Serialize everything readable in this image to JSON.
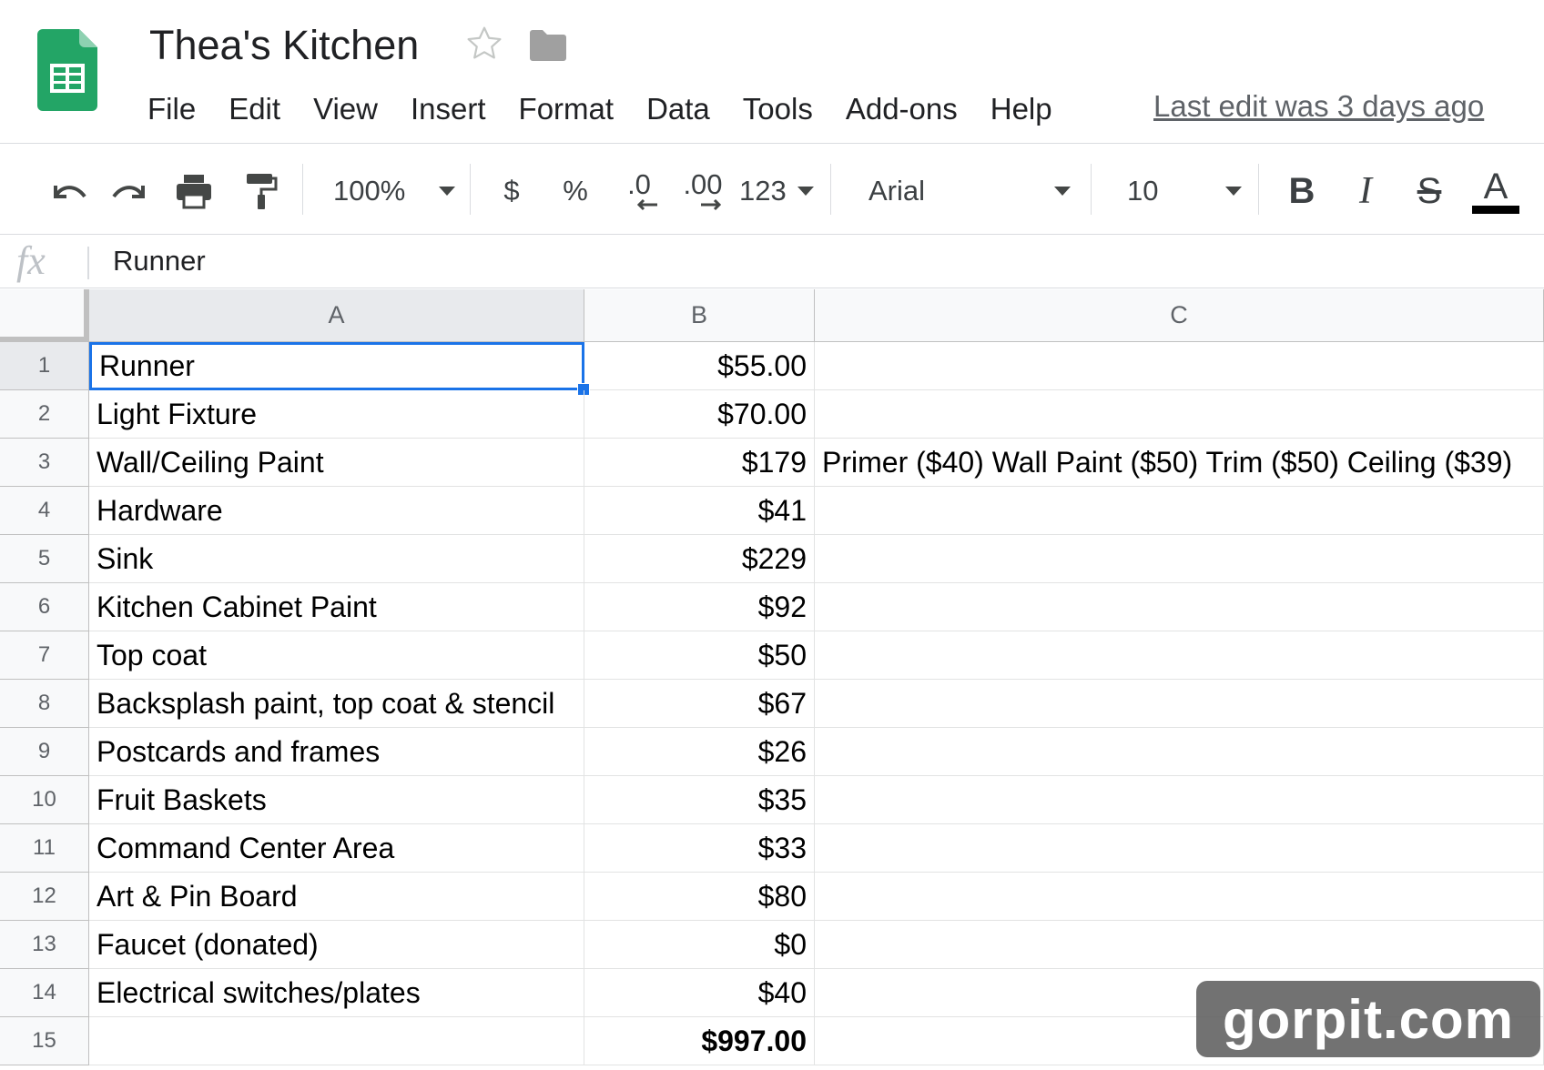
{
  "header": {
    "title": "Thea's Kitchen",
    "menu": [
      "File",
      "Edit",
      "View",
      "Insert",
      "Format",
      "Data",
      "Tools",
      "Add-ons",
      "Help"
    ],
    "last_edit": "Last edit was 3 days ago"
  },
  "toolbar": {
    "zoom": "100%",
    "currency": "$",
    "percent": "%",
    "decrease_decimal": ".0",
    "increase_decimal": ".00",
    "more_formats": "123",
    "font": "Arial",
    "font_size": "10",
    "bold": "B",
    "italic": "I",
    "strike": "S",
    "text_color": "A"
  },
  "formula_bar": {
    "fx": "fx",
    "value": "Runner"
  },
  "grid": {
    "columns": [
      "A",
      "B",
      "C"
    ],
    "rows": [
      {
        "n": "1",
        "a": "Runner",
        "b": "$55.00",
        "c": ""
      },
      {
        "n": "2",
        "a": "Light Fixture",
        "b": "$70.00",
        "c": ""
      },
      {
        "n": "3",
        "a": "Wall/Ceiling Paint",
        "b": "$179",
        "c": "Primer ($40) Wall Paint ($50) Trim ($50) Ceiling ($39)"
      },
      {
        "n": "4",
        "a": "Hardware",
        "b": "$41",
        "c": ""
      },
      {
        "n": "5",
        "a": "Sink",
        "b": "$229",
        "c": ""
      },
      {
        "n": "6",
        "a": "Kitchen Cabinet Paint",
        "b": "$92",
        "c": ""
      },
      {
        "n": "7",
        "a": "Top coat",
        "b": "$50",
        "c": ""
      },
      {
        "n": "8",
        "a": "Backsplash paint, top coat & stencil",
        "b": "$67",
        "c": ""
      },
      {
        "n": "9",
        "a": "Postcards and frames",
        "b": "$26",
        "c": ""
      },
      {
        "n": "10",
        "a": "Fruit Baskets",
        "b": "$35",
        "c": ""
      },
      {
        "n": "11",
        "a": "Command Center Area",
        "b": "$33",
        "c": ""
      },
      {
        "n": "12",
        "a": "Art & Pin Board",
        "b": "$80",
        "c": ""
      },
      {
        "n": "13",
        "a": "Faucet (donated)",
        "b": "$0",
        "c": ""
      },
      {
        "n": "14",
        "a": "Electrical switches/plates",
        "b": "$40",
        "c": ""
      },
      {
        "n": "15",
        "a": "",
        "b": "$997.00",
        "c": ""
      }
    ],
    "selected_cell": "A1"
  },
  "watermark": "gorpit.com",
  "colors": {
    "sheets_green": "#23a566",
    "selection_blue": "#1a73e8",
    "header_bg": "#f8f9fa",
    "gridline": "#e2e3e3"
  }
}
